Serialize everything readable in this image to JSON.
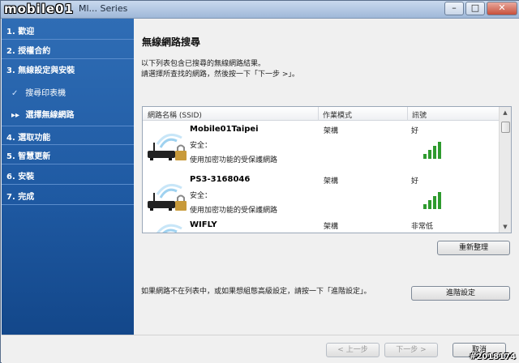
{
  "window": {
    "logo_text": "mobile01",
    "title": "Ml... Series",
    "minimize": "–",
    "maximize": "□",
    "close": "✕"
  },
  "sidebar": {
    "steps": [
      {
        "label": "1. 歡迎"
      },
      {
        "label": "2. 授權合約"
      },
      {
        "label": "3. 無線設定與安裝"
      },
      {
        "label": "4. 選取功能"
      },
      {
        "label": "5. 智慧更新"
      },
      {
        "label": "6. 安裝"
      },
      {
        "label": "7. 完成"
      }
    ],
    "substeps": [
      {
        "icon": "✓",
        "label": "搜尋印表機"
      },
      {
        "icon": "▸▸",
        "label": "選擇無線網路"
      }
    ]
  },
  "main": {
    "heading": "無線網路搜尋",
    "desc_line1": "以下列表包含已搜尋的無線網路結果。",
    "desc_line2": "請選擇所查找的網路，然後按一下「下一步 >」。",
    "columns": [
      "網路名稱 (SSID)",
      "作業模式",
      "訊號"
    ],
    "networks": [
      {
        "ssid": "Mobile01Taipei",
        "mode": "架構",
        "signal": "好",
        "security_label": "安全：",
        "security_desc": "使用加密功能的受保護網路",
        "signal_level": 4
      },
      {
        "ssid": "PS3-3168046",
        "mode": "架構",
        "signal": "好",
        "security_label": "安全：",
        "security_desc": "使用加密功能的受保護網路",
        "signal_level": 4
      },
      {
        "ssid": "WIFLY",
        "mode": "架構",
        "signal": "非常低",
        "security_label": "",
        "security_desc": "",
        "signal_level": 1
      }
    ],
    "refresh_button": "重新整理",
    "footnote": "如果網路不在列表中，或如果想組態高級設定，請按一下「進階設定」。",
    "advanced_button": "進階設定"
  },
  "footer": {
    "back_button": "< 上一步",
    "next_button": "下一步 >",
    "cancel_button": "取消",
    "watermark": "#2018174"
  },
  "colors": {
    "sidebar_top": "#2f6db5",
    "sidebar_bottom": "#13478a",
    "signal_green": "#2e9b2e"
  }
}
